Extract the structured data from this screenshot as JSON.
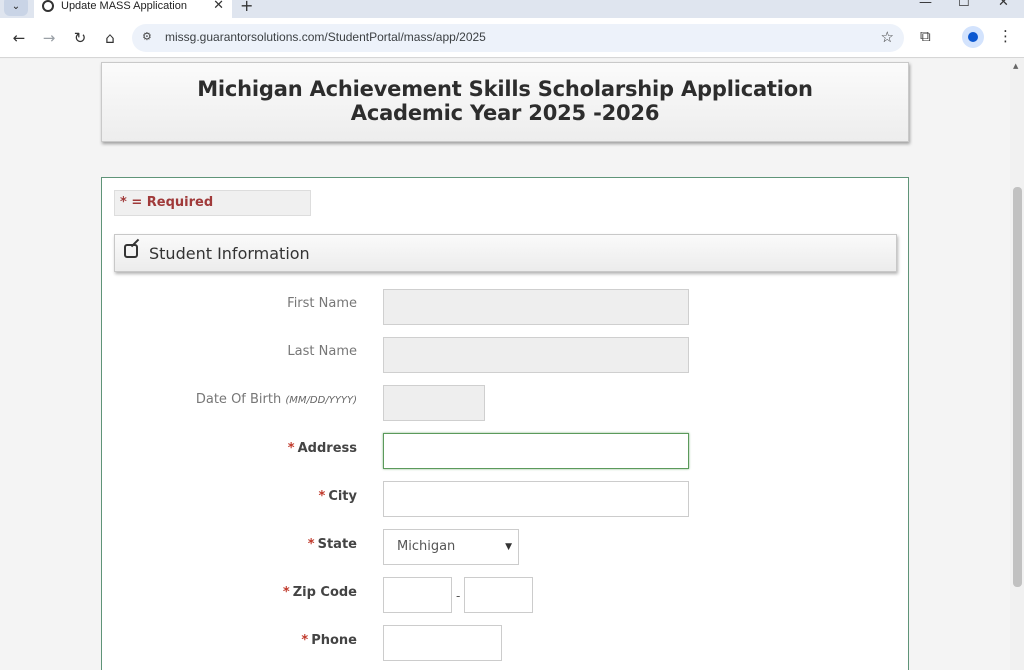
{
  "browser": {
    "tab_title": "Update MASS Application",
    "tab_close": "✕",
    "new_tab": "+",
    "url": "missg.guarantorsolutions.com/StudentPortal/mass/app/2025",
    "window_controls": [
      "—",
      "☐",
      "✕"
    ],
    "icons": [
      "back-icon",
      "forward-icon",
      "reload-icon",
      "home-icon",
      "site-info-icon",
      "star-icon",
      "extensions-icon",
      "profile-icon",
      "menu-icon"
    ]
  },
  "page": {
    "title_line1": "Michigan Achievement Skills Scholarship Application",
    "title_line2": "Academic Year 2025 -2026",
    "required_note": "* = Required",
    "section_title": "Student Information",
    "fields": {
      "first_name": {
        "label": "First Name",
        "value": ""
      },
      "last_name": {
        "label": "Last Name",
        "value": ""
      },
      "dob": {
        "label": "Date Of Birth",
        "hint": "(MM/DD/YYYY)",
        "value": ""
      },
      "address": {
        "required": "*",
        "label": "Address",
        "value": ""
      },
      "city": {
        "required": "*",
        "label": "City",
        "value": ""
      },
      "state": {
        "required": "*",
        "label": "State",
        "value": "Michigan"
      },
      "zip": {
        "required": "*",
        "label": "Zip Code",
        "separator": "-",
        "value": ""
      },
      "phone": {
        "required": "*",
        "label": "Phone",
        "value": ""
      }
    }
  },
  "colors": {
    "required_text": "#a03a3a",
    "form_border": "#5f9478",
    "focus_border": "#5b9a5b"
  }
}
